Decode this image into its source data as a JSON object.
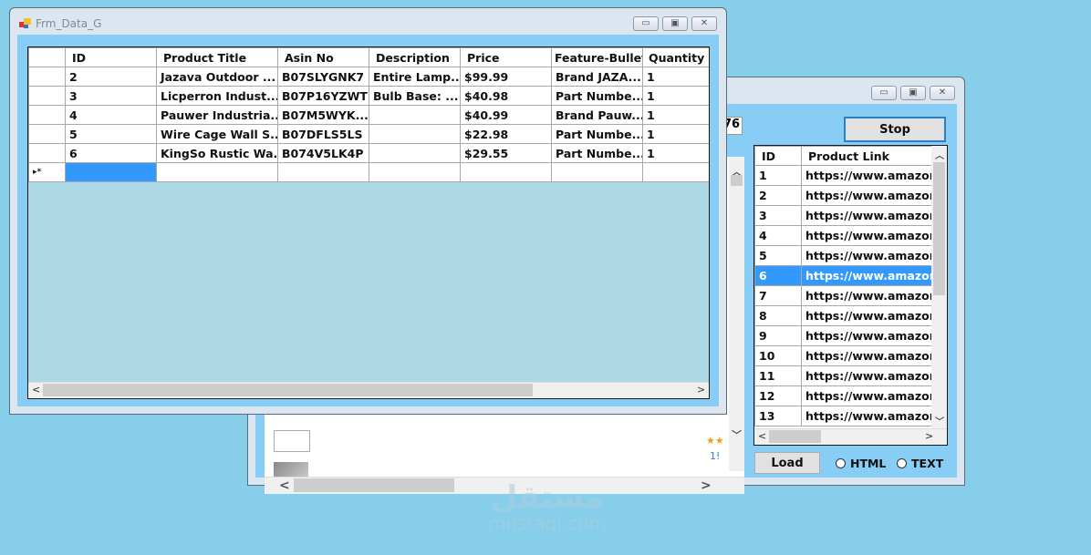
{
  "back_window": {
    "counter_text": "76",
    "stop_label": "Stop",
    "load_label": "Load",
    "radio_options": [
      {
        "label": "HTML",
        "checked": false
      },
      {
        "label": "TEXT",
        "checked": false
      }
    ],
    "browser_partial_text": "1!",
    "links_grid": {
      "columns": [
        "ID",
        "Product Link"
      ],
      "selected_row": 6,
      "rows": [
        {
          "id": "1",
          "link": "https://www.amazon"
        },
        {
          "id": "2",
          "link": "https://www.amazon"
        },
        {
          "id": "3",
          "link": "https://www.amazon"
        },
        {
          "id": "4",
          "link": "https://www.amazon"
        },
        {
          "id": "5",
          "link": "https://www.amazon"
        },
        {
          "id": "6",
          "link": "https://www.amazon"
        },
        {
          "id": "7",
          "link": "https://www.amazon"
        },
        {
          "id": "8",
          "link": "https://www.amazon"
        },
        {
          "id": "9",
          "link": "https://www.amazon"
        },
        {
          "id": "10",
          "link": "https://www.amazon"
        },
        {
          "id": "11",
          "link": "https://www.amazon"
        },
        {
          "id": "12",
          "link": "https://www.amazon"
        },
        {
          "id": "13",
          "link": "https://www.amazon"
        }
      ]
    }
  },
  "front_window": {
    "title": "Frm_Data_G",
    "new_row_marker": "▸*",
    "data_grid": {
      "columns": [
        "ID",
        "Product Title",
        "Asin No",
        "Description",
        "Price",
        "Feature-Bullet",
        "Quantity"
      ],
      "rows": [
        {
          "id": "2",
          "title": "Jazava Outdoor ...",
          "asin": "B07SLYGNK7",
          "description": "Entire Lamp...",
          "price": "$99.99",
          "feature": "Brand JAZA...",
          "quantity": "1"
        },
        {
          "id": "3",
          "title": "Licperron Indust...",
          "asin": "B07P16YZWT",
          "description": "Bulb Base: ...",
          "price": "$40.98",
          "feature": "Part Numbe...",
          "quantity": "1"
        },
        {
          "id": "4",
          "title": "Pauwer Industria...",
          "asin": "B07M5WYK...",
          "description": "",
          "price": "$40.99",
          "feature": "Brand Pauw...",
          "quantity": "1"
        },
        {
          "id": "5",
          "title": "Wire Cage Wall S...",
          "asin": "B07DFLS5LS",
          "description": "",
          "price": "$22.98",
          "feature": "Part Numbe...",
          "quantity": "1"
        },
        {
          "id": "6",
          "title": "KingSo Rustic Wa...",
          "asin": "B074V5LK4P",
          "description": "",
          "price": "$29.55",
          "feature": "Part Numbe...",
          "quantity": "1"
        }
      ]
    }
  },
  "watermark": {
    "arabic": "مستقل",
    "latin": "mostaql.com"
  }
}
